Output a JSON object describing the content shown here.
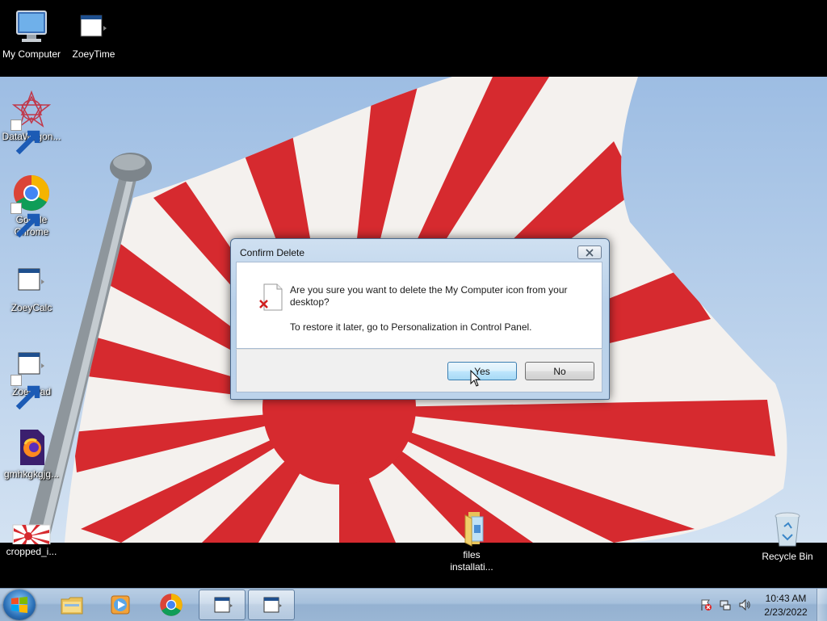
{
  "desktop": {
    "icons": [
      {
        "label": "My Computer",
        "icon": "computer-icon"
      },
      {
        "label": "ZoeyTime",
        "icon": "app-window-icon"
      },
      {
        "label": "DataWagon...",
        "icon": "datawagon-icon"
      },
      {
        "label": "Google Chrome",
        "icon": "chrome-icon"
      },
      {
        "label": "ZoeyCalc",
        "icon": "app-window-icon"
      },
      {
        "label": "ZoeyPad",
        "icon": "app-window-icon"
      },
      {
        "label": "gmhkgkgjg...",
        "icon": "firefox-file-icon"
      },
      {
        "label": "cropped_i...",
        "icon": "image-thumbnail-icon"
      },
      {
        "label": "files installati...",
        "icon": "folder-icon"
      },
      {
        "label": "Recycle Bin",
        "icon": "recycle-bin-icon"
      }
    ]
  },
  "dialog": {
    "title": "Confirm Delete",
    "message_line1": "Are you sure you want to delete the My Computer icon from your desktop?",
    "message_line2": "To restore it later, go to Personalization in Control Panel.",
    "yes_label": "Yes",
    "no_label": "No"
  },
  "taskbar": {
    "pinned": [
      {
        "name": "explorer",
        "icon": "folder-icon"
      },
      {
        "name": "media-player",
        "icon": "media-player-icon"
      },
      {
        "name": "chrome",
        "icon": "chrome-icon"
      },
      {
        "name": "window-1",
        "icon": "app-window-icon"
      },
      {
        "name": "window-2",
        "icon": "app-window-icon"
      }
    ],
    "clock_time": "10:43 AM",
    "clock_date": "2/23/2022"
  },
  "colors": {
    "flag_red": "#d62a2f",
    "sky": "#a9c6e6",
    "taskbar": "#a6c0dc"
  }
}
